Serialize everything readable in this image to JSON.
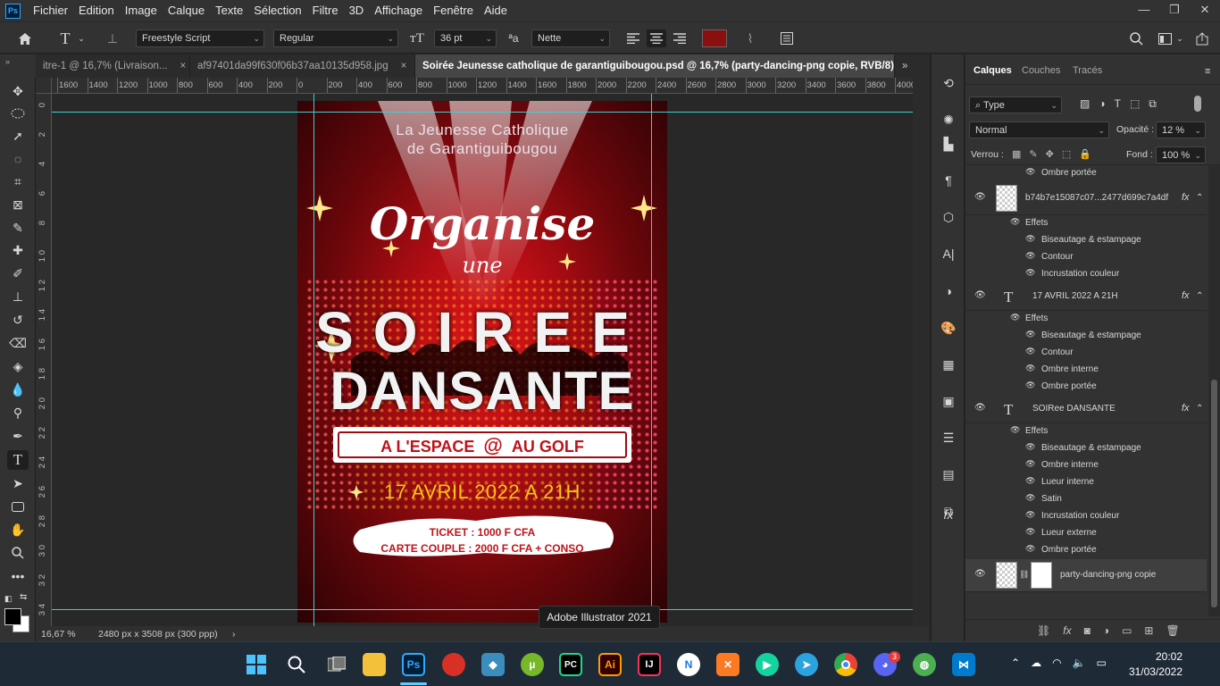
{
  "menubar": {
    "items": [
      "Fichier",
      "Edition",
      "Image",
      "Calque",
      "Texte",
      "Sélection",
      "Filtre",
      "3D",
      "Affichage",
      "Fenêtre",
      "Aide"
    ],
    "window_controls": [
      "—",
      "❐",
      "✕"
    ]
  },
  "options": {
    "font_family": "Freestyle Script",
    "font_style": "Regular",
    "font_size": "36 pt",
    "aa_label": "ªa",
    "antialias": "Nette",
    "text_color": "#8b0f0f"
  },
  "tabs": [
    {
      "label": "itre-1 @ 16,7% (Livraison...",
      "active": false
    },
    {
      "label": "af97401da99f630f06b37aa10135d958.jpg",
      "active": false
    },
    {
      "label": "Soirée Jeunesse catholique de garantiguibougou.psd @ 16,7% (party-dancing-png copie, RVB/8)",
      "active": true
    }
  ],
  "ruler_h": [
    "1600",
    "1400",
    "1200",
    "1000",
    "800",
    "600",
    "400",
    "200",
    "0",
    "200",
    "400",
    "600",
    "800",
    "1000",
    "1200",
    "1400",
    "1600",
    "1800",
    "2000",
    "2200",
    "2400",
    "2600",
    "2800",
    "3000",
    "3200",
    "3400",
    "3600",
    "3800",
    "4000"
  ],
  "ruler_v": [
    "0",
    "2",
    "4",
    "6",
    "8",
    "1 0",
    "1 2",
    "1 4",
    "1 6",
    "1 8",
    "2 0",
    "2 2",
    "2 4",
    "2 6",
    "2 8",
    "3 0",
    "3 2",
    "3 4"
  ],
  "poster": {
    "line1": "La Jeunesse Catholique",
    "line2": "de Garantiguibougou",
    "organise": "Organise",
    "une": "une",
    "soiree": "SOIREE",
    "dansante": "DANSANTE",
    "lieu_left": "A L'ESPACE",
    "lieu_at": "@",
    "lieu_right": "AU GOLF",
    "date": "17 AVRIL 2022 A 21H",
    "ticket": "TICKET : 1000 F CFA",
    "couple": "CARTE COUPLE : 2000 F CFA + CONSO"
  },
  "status": {
    "zoom": "16,67 %",
    "doc_size": "2480 px x 3508 px (300 ppp)",
    "arrow": "›"
  },
  "tooltip": "Adobe Illustrator 2021",
  "panel": {
    "tabs": [
      "Calques",
      "Couches",
      "Tracés"
    ],
    "filter": "Type",
    "blend_mode": "Normal",
    "opacity_label": "Opacité :",
    "opacity": "12 %",
    "lock_label": "Verrou :",
    "fill_label": "Fond :",
    "fill": "100 %",
    "fx": "fx",
    "layers": [
      {
        "type": "effect",
        "label": "Ombre portée"
      },
      {
        "type": "layer",
        "name": "b74b7e15087c07...2477d699c7a4df",
        "kind": "image"
      },
      {
        "type": "effects-header",
        "label": "Effets"
      },
      {
        "type": "effect",
        "label": "Biseautage & estampage"
      },
      {
        "type": "effect",
        "label": "Contour"
      },
      {
        "type": "effect",
        "label": "Incrustation couleur"
      },
      {
        "type": "layer",
        "name": "17 AVRIL 2022 A 21H",
        "kind": "text"
      },
      {
        "type": "effects-header",
        "label": "Effets"
      },
      {
        "type": "effect",
        "label": "Biseautage & estampage"
      },
      {
        "type": "effect",
        "label": "Contour"
      },
      {
        "type": "effect",
        "label": "Ombre interne"
      },
      {
        "type": "effect",
        "label": "Ombre portée"
      },
      {
        "type": "layer",
        "name": "SOIRee DANSANTE",
        "kind": "text"
      },
      {
        "type": "effects-header",
        "label": "Effets"
      },
      {
        "type": "effect",
        "label": "Biseautage & estampage"
      },
      {
        "type": "effect",
        "label": "Ombre interne"
      },
      {
        "type": "effect",
        "label": "Lueur interne"
      },
      {
        "type": "effect",
        "label": "Satin"
      },
      {
        "type": "effect",
        "label": "Incrustation couleur"
      },
      {
        "type": "effect",
        "label": "Lueur externe"
      },
      {
        "type": "effect",
        "label": "Ombre portée"
      },
      {
        "type": "layer",
        "name": "party-dancing-png copie",
        "kind": "image-mask"
      }
    ]
  },
  "taskbar": {
    "icons": [
      "windows-start",
      "search",
      "task-view",
      "file-explorer",
      "photoshop",
      "app-6",
      "app-7",
      "utorrent",
      "pycharm",
      "illustrator",
      "intellij",
      "app-12",
      "xampp",
      "app-14",
      "telegram",
      "chrome",
      "discord",
      "app-18",
      "vscode"
    ],
    "discord_badge": "3",
    "time": "20:02",
    "date": "31/03/2022"
  }
}
